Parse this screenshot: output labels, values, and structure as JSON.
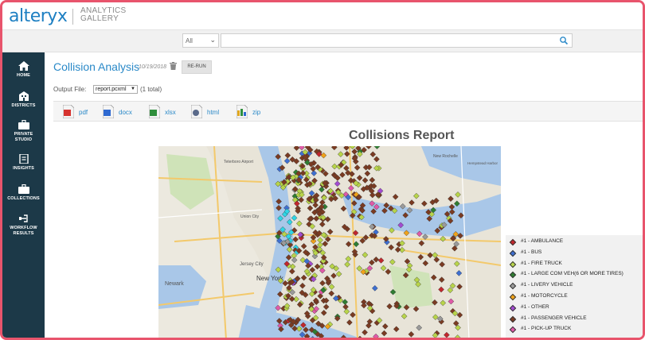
{
  "app": {
    "logo": "alteryx",
    "subtitle_line1": "ANALYTICS",
    "subtitle_line2": "GALLERY"
  },
  "search": {
    "scope_value": "All",
    "placeholder": ""
  },
  "sidebar": {
    "items": [
      {
        "label": "HOME",
        "icon": "home-icon"
      },
      {
        "label": "DISTRICTS",
        "icon": "building-icon"
      },
      {
        "label_line1": "PRIVATE",
        "label_line2": "STUDIO",
        "icon": "briefcase-icon"
      },
      {
        "label": "INSIGHTS",
        "icon": "insights-icon"
      },
      {
        "label": "COLLECTIONS",
        "icon": "briefcase-icon"
      },
      {
        "label_line1": "WORKFLOW",
        "label_line2": "RESULTS",
        "icon": "workflow-icon"
      }
    ],
    "active": "WORKFLOW RESULTS"
  },
  "page": {
    "title": "Collision Analysis",
    "date": "10/19/2018",
    "rerun_label": "RE-RUN",
    "output_file_label": "Output File:",
    "output_file_value": "report.pcxml",
    "output_count": "(1 total)"
  },
  "downloads": [
    {
      "label": "pdf",
      "icon": "pdf-file-icon"
    },
    {
      "label": "docx",
      "icon": "docx-file-icon"
    },
    {
      "label": "xlsx",
      "icon": "xlsx-file-icon"
    },
    {
      "label": "html",
      "icon": "html-file-icon"
    },
    {
      "label": "zip",
      "icon": "zip-file-icon"
    }
  ],
  "report": {
    "title": "Collisions Report",
    "map_labels": {
      "airport": "Teterboro Airport",
      "newark": "Newark",
      "union_city": "Union City",
      "jersey_city": "Jersey City",
      "new_york": "New York",
      "new_rochelle": "New Rochelle",
      "hempstead": "Hempstead Harbor"
    }
  },
  "legend": [
    {
      "label": "#1 - AMBULANCE",
      "color": "#c0272d"
    },
    {
      "label": "#1 - BUS",
      "color": "#3e6fd1"
    },
    {
      "label": "#1 - FIRE TRUCK",
      "color": "#b8d44a"
    },
    {
      "label": "#1 - LARGE COM VEH(6 OR MORE TIRES)",
      "color": "#2f7d32"
    },
    {
      "label": "#1 - LIVERY VEHICLE",
      "color": "#9a9a9a"
    },
    {
      "label": "#1 - MOTORCYCLE",
      "color": "#f0a21a"
    },
    {
      "label": "#1 - OTHER",
      "color": "#a24bd1"
    },
    {
      "label": "#1 - PASSENGER VEHICLE",
      "color": "#7a3b22"
    },
    {
      "label": "#1 - PICK-UP TRUCK",
      "color": "#e05aa8"
    }
  ]
}
